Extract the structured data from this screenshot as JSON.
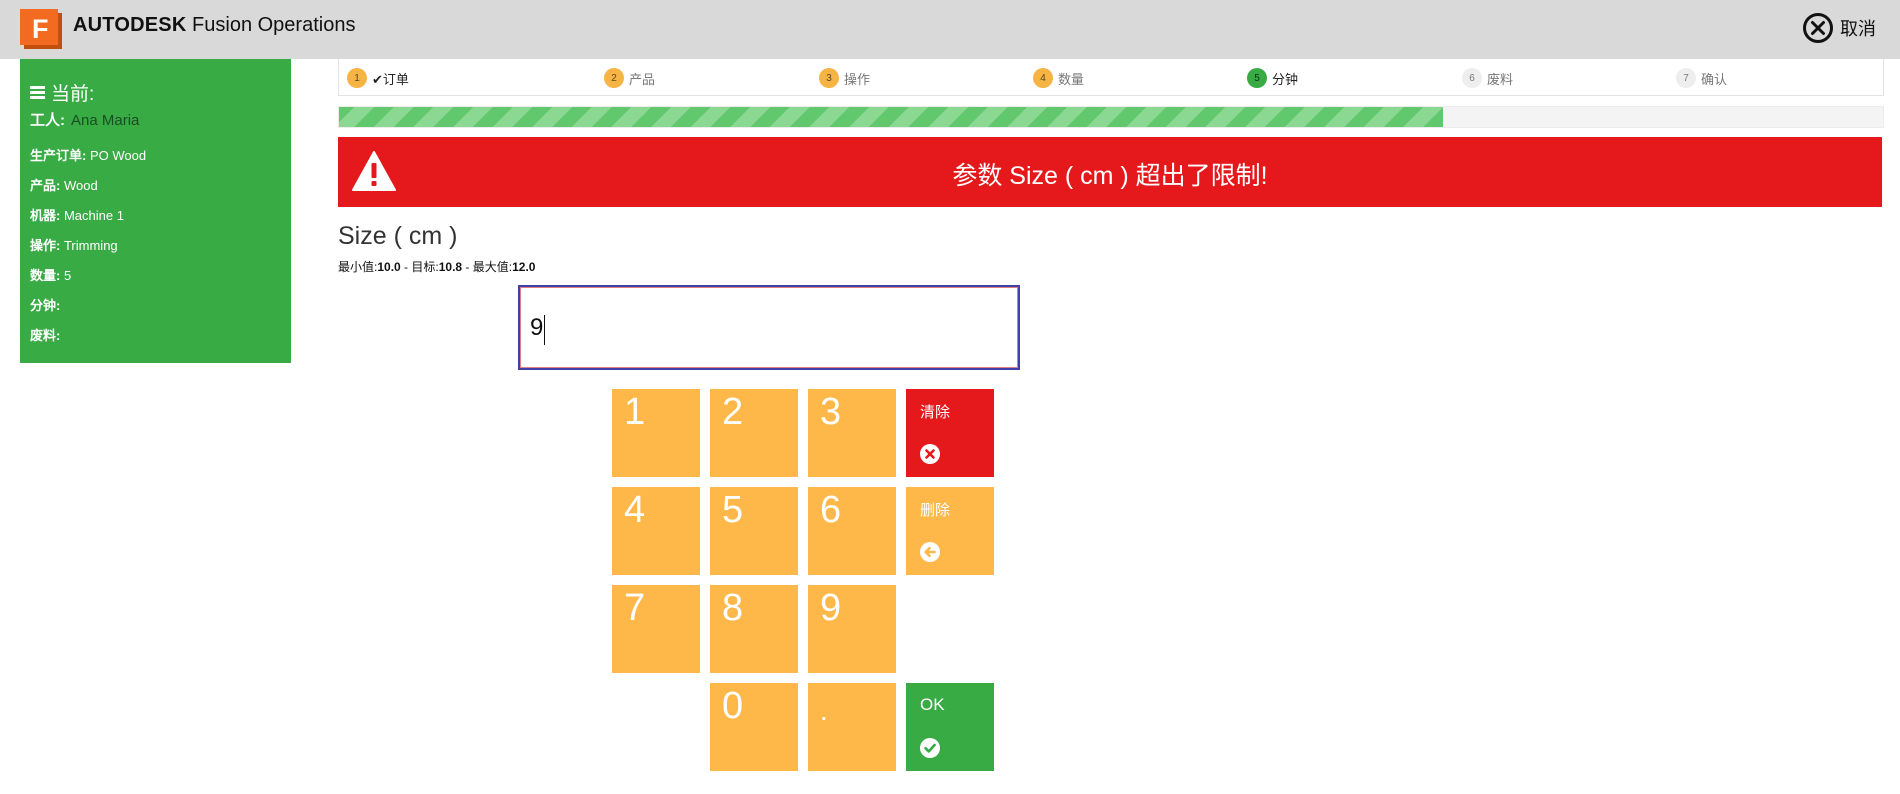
{
  "header": {
    "brand_bold": "AUTODESK",
    "brand_rest": "Fusion Operations",
    "logo_letter": "F",
    "cancel_label": "取消",
    "colors": {
      "logo": "#f26b21"
    }
  },
  "sidebar": {
    "title": "当前:",
    "worker_label": "工人:",
    "worker_value": "Ana Maria",
    "rows": [
      {
        "key": "生产订单:",
        "value": "PO Wood"
      },
      {
        "key": "产品:",
        "value": "Wood"
      },
      {
        "key": "机器:",
        "value": "Machine 1"
      },
      {
        "key": "操作:",
        "value": "Trimming"
      },
      {
        "key": "数量:",
        "value": "5"
      },
      {
        "key": "分钟:",
        "value": ""
      },
      {
        "key": "废料:",
        "value": ""
      }
    ]
  },
  "steps": [
    {
      "num": "1",
      "label": "订单",
      "check": "✔",
      "state": "done"
    },
    {
      "num": "2",
      "label": "产品",
      "state": "done"
    },
    {
      "num": "3",
      "label": "操作",
      "state": "done"
    },
    {
      "num": "4",
      "label": "数量",
      "state": "done"
    },
    {
      "num": "5",
      "label": "分钟",
      "state": "active"
    },
    {
      "num": "6",
      "label": "废料",
      "state": "todo"
    },
    {
      "num": "7",
      "label": "确认",
      "state": "todo"
    }
  ],
  "progress": {
    "fraction": 0.715
  },
  "alert": {
    "message": "参数 Size ( cm ) 超出了限制!",
    "icon": "warning-icon"
  },
  "parameter": {
    "name": "Size ( cm )",
    "min_label": "最小值:",
    "min_value": "10.0",
    "sep": " - ",
    "target_label": "目标:",
    "target_value": "10.8",
    "max_label": "最大值:",
    "max_value": "12.0"
  },
  "input": {
    "value": "9"
  },
  "keypad": {
    "k1": "1",
    "k2": "2",
    "k3": "3",
    "k4": "4",
    "k5": "5",
    "k6": "6",
    "k7": "7",
    "k8": "8",
    "k9": "9",
    "k0": "0",
    "kdot": ".",
    "clear": "清除",
    "delete": "删除",
    "ok": "OK"
  }
}
